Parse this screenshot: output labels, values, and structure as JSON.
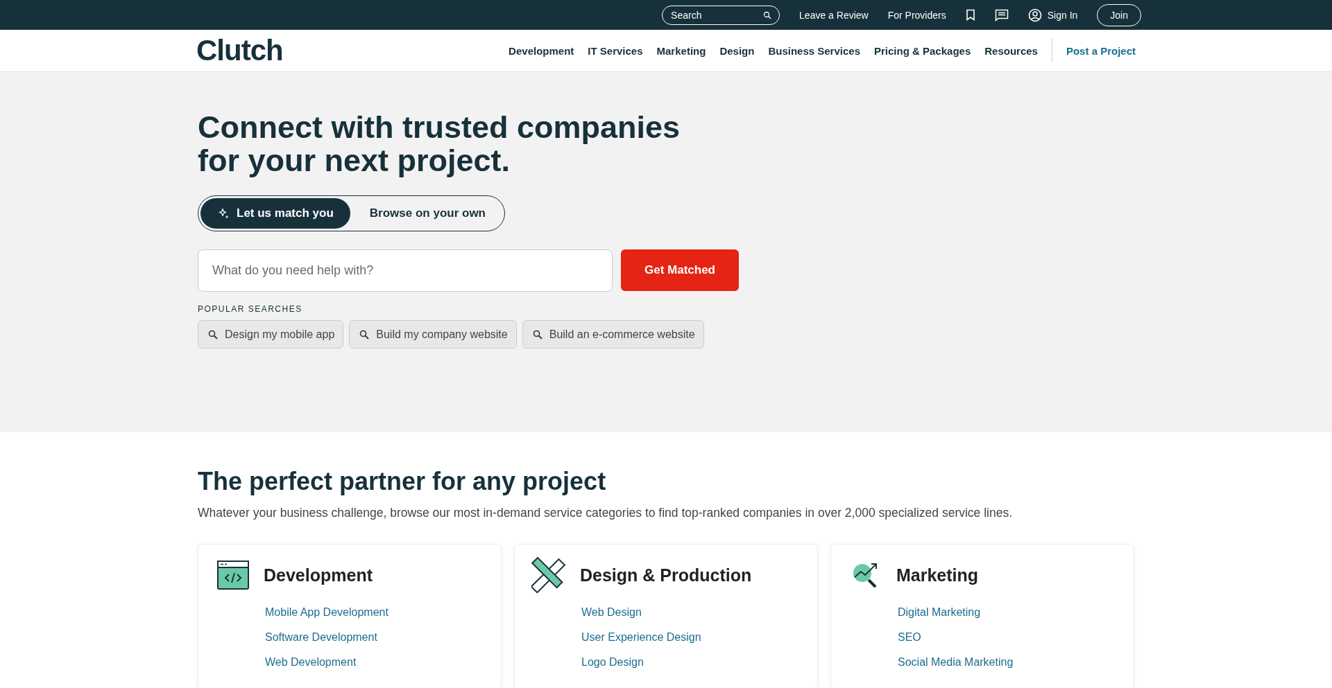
{
  "top_bar": {
    "search": {
      "placeholder": "Search"
    },
    "links": [
      "Leave a Review",
      "For Providers"
    ],
    "sign_in": "Sign In",
    "join": "Join"
  },
  "header": {
    "logo": "Clutch",
    "nav": [
      "Development",
      "IT Services",
      "Marketing",
      "Design",
      "Business Services",
      "Pricing & Packages",
      "Resources"
    ],
    "cta": "Post a Project"
  },
  "hero": {
    "title": "Connect with trusted companies for your next project.",
    "modes": [
      {
        "label": "Let us match you",
        "selected": true
      },
      {
        "label": "Browse on your own",
        "selected": false
      }
    ],
    "search": {
      "placeholder": "What do you need help with?",
      "button": "Get Matched"
    },
    "popular_label": "POPULAR SEARCHES",
    "popular": [
      "Design my mobile app",
      "Build my company website",
      "Build an e-commerce website"
    ]
  },
  "section": {
    "title": "The perfect partner for any project",
    "subtitle": "Whatever your business challenge, browse our most in-demand service categories to find top-ranked companies in over 2,000 specialized service lines.",
    "cards": [
      {
        "kind": "code",
        "title": "Development",
        "links": [
          "Mobile App Development",
          "Software Development",
          "Web Development"
        ]
      },
      {
        "kind": "design",
        "title": "Design & Production",
        "links": [
          "Web Design",
          "User Experience Design",
          "Logo Design"
        ]
      },
      {
        "kind": "growth",
        "title": "Marketing",
        "links": [
          "Digital Marketing",
          "SEO",
          "Social Media Marketing"
        ]
      }
    ]
  }
}
